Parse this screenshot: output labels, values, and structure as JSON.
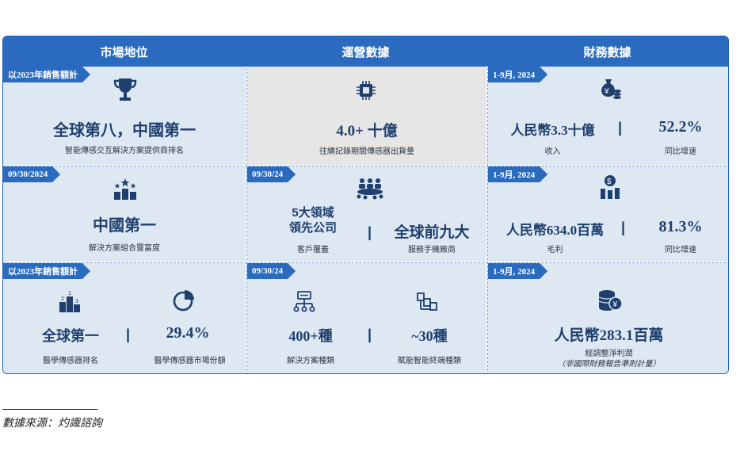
{
  "headers": [
    "市場地位",
    "運營數據",
    "財務數據"
  ],
  "market": {
    "r1": {
      "tag": "以2023年銷售額計",
      "big": "全球第八，中國第一",
      "sub": "智能傳感交互解決方案提供商排名"
    },
    "r2": {
      "tag": "09/30/2024",
      "big": "中國第一",
      "sub": "解決方案組合豐富度"
    },
    "r3": {
      "tag": "以2023年銷售額計",
      "left_big": "全球第一",
      "left_sub": "醫學傳感器排名",
      "right_big": "29.4%",
      "right_sub": "醫學傳感器市場份額"
    }
  },
  "operations": {
    "r1": {
      "big": "4.0+ 十億",
      "sub": "往績記錄期間傳感器出貨量"
    },
    "r2": {
      "tag": "09/30/24",
      "left_big_1": "5大領域",
      "left_big_2": "領先公司",
      "left_sub": "客戶覆蓋",
      "right_big": "全球前九大",
      "right_sub": "服務手機廠商"
    },
    "r3": {
      "tag": "09/30/24",
      "left_big": "400+種",
      "left_sub": "解決方案種類",
      "right_big": "~30種",
      "right_sub": "賦能智能終端種類"
    }
  },
  "financials": {
    "r1": {
      "tag": "1-9月, 2024",
      "left_big": "人民幣3.3十億",
      "left_sub": "收入",
      "right_big": "52.2%",
      "right_sub": "同比增速"
    },
    "r2": {
      "tag": "1-9月, 2024",
      "left_big": "人民幣634.0百萬",
      "left_sub": "毛利",
      "right_big": "81.3%",
      "right_sub": "同比增速"
    },
    "r3": {
      "tag": "1-9月, 2024",
      "big": "人民幣283.1百萬",
      "sub1": "經調整淨利潤",
      "sub2": "（非國際財務報告準則計量）"
    }
  },
  "separator": "|",
  "footnote": "數據來源：灼識諮詢",
  "colors": {
    "header_blue": "#2b6bbf",
    "navy_text": "#1f3f6e",
    "light_panel": "#dde8f3",
    "gray_panel": "#e6e6e6"
  },
  "icons": [
    "trophy-icon",
    "chip-icon",
    "money-bag-icon",
    "podium-stars-icon",
    "meeting-icon",
    "dollar-chart-icon",
    "ranking-podium-icon",
    "pie-chart-icon",
    "hierarchy-icon",
    "device-network-icon",
    "coin-stack-icon"
  ]
}
